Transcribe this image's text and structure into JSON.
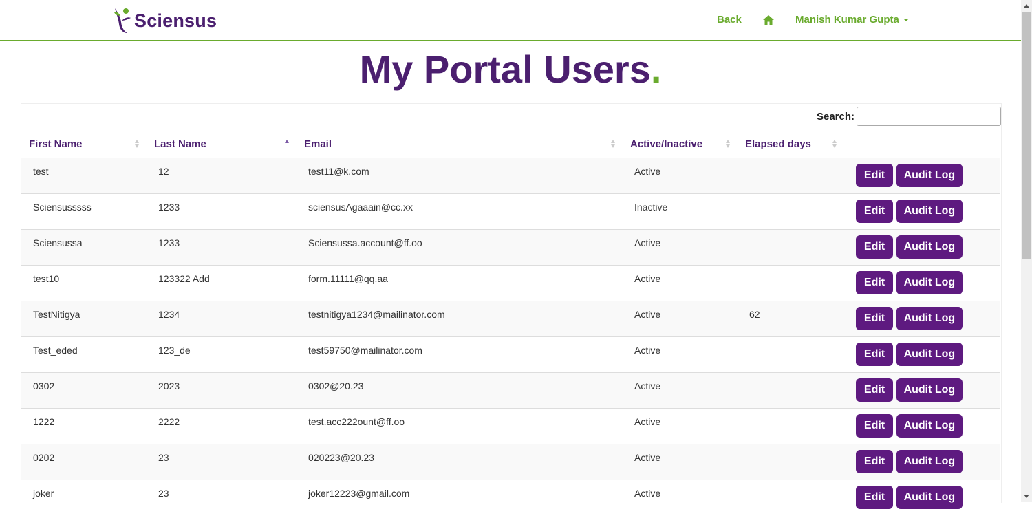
{
  "header": {
    "brand": "Sciensus",
    "nav": {
      "back_label": "Back",
      "user_name": "Manish Kumar Gupta"
    },
    "colors": {
      "brand_purple": "#4b1f6f",
      "accent_green": "#6aab2e",
      "button_purple": "#5e1a80"
    }
  },
  "page": {
    "title": "My Portal Users",
    "title_dot": "."
  },
  "search": {
    "label": "Search:",
    "value": ""
  },
  "table": {
    "columns": [
      "First Name",
      "Last Name",
      "Email",
      "Active/Inactive",
      "Elapsed days"
    ],
    "sorted_column": "Last Name",
    "sort_direction": "asc",
    "rows": [
      {
        "first": "test",
        "last": "12",
        "email": "test11@k.com",
        "status": "Active",
        "days": ""
      },
      {
        "first": "Sciensusssss",
        "last": "1233",
        "email": "sciensusAgaaain@cc.xx",
        "status": "Inactive",
        "days": ""
      },
      {
        "first": "Sciensussa",
        "last": "1233",
        "email": "Sciensussa.account@ff.oo",
        "status": "Active",
        "days": ""
      },
      {
        "first": "test10",
        "last": "123322 Add",
        "email": "form.11111@qq.aa",
        "status": "Active",
        "days": ""
      },
      {
        "first": "TestNitigya",
        "last": "1234",
        "email": "testnitigya1234@mailinator.com",
        "status": "Active",
        "days": "62"
      },
      {
        "first": "Test_eded",
        "last": "123_de",
        "email": "test59750@mailinator.com",
        "status": "Active",
        "days": ""
      },
      {
        "first": "0302",
        "last": "2023",
        "email": "0302@20.23",
        "status": "Active",
        "days": ""
      },
      {
        "first": "1222",
        "last": "2222",
        "email": "test.acc222ount@ff.oo",
        "status": "Active",
        "days": ""
      },
      {
        "first": "0202",
        "last": "23",
        "email": "020223@20.23",
        "status": "Active",
        "days": ""
      },
      {
        "first": "joker",
        "last": "23",
        "email": "joker12223@gmail.com",
        "status": "Active",
        "days": ""
      }
    ],
    "actions": {
      "edit_label": "Edit",
      "audit_label": "Audit Log"
    }
  }
}
